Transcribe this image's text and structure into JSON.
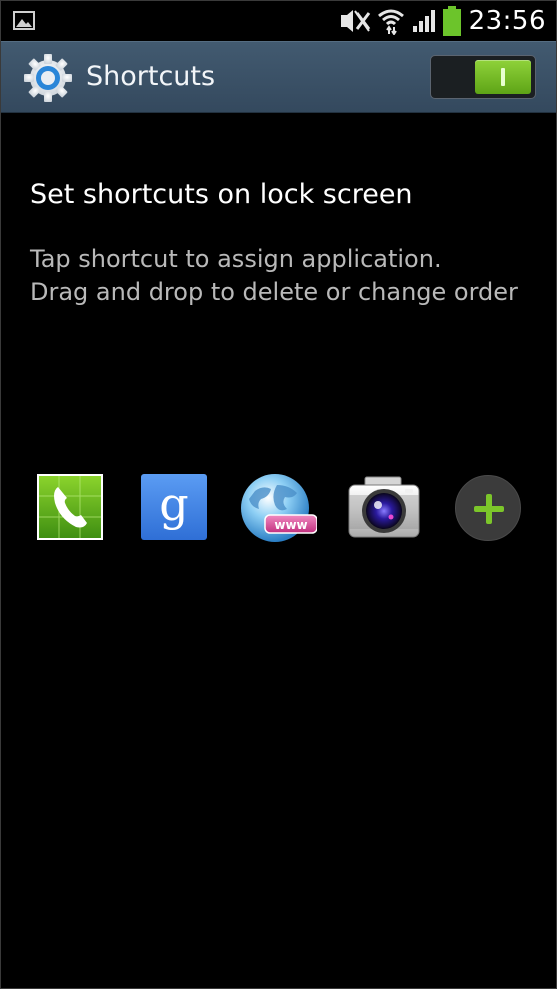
{
  "status_bar": {
    "time": "23:56",
    "icons": [
      "picture-icon",
      "mute-icon",
      "wifi-icon",
      "signal-icon",
      "battery-icon"
    ],
    "battery_color": "#6cc42b"
  },
  "action_bar": {
    "title": "Shortcuts",
    "toggle_on": true,
    "accent": "#7cc62a",
    "background": "#3c5266"
  },
  "content": {
    "heading": "Set shortcuts on lock screen",
    "instructions": [
      "Tap shortcut to assign application.",
      "Drag and drop to delete or change order"
    ]
  },
  "shortcuts": [
    {
      "name": "phone",
      "icon": "phone-icon"
    },
    {
      "name": "google",
      "icon": "google-icon"
    },
    {
      "name": "internet",
      "icon": "globe-www-icon",
      "badge": "www"
    },
    {
      "name": "camera",
      "icon": "camera-icon"
    },
    {
      "name": "add",
      "icon": "plus-icon"
    }
  ]
}
